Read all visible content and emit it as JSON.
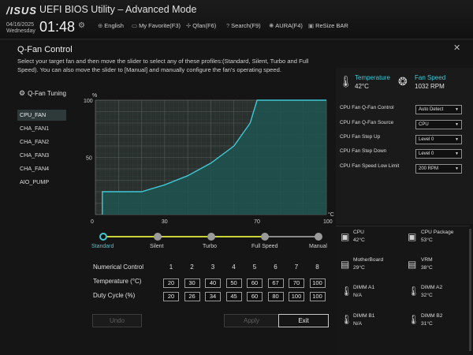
{
  "header": {
    "logo": "/ISUS",
    "title": "UEFI BIOS Utility – Advanced Mode",
    "date": "04/16/2025",
    "weekday": "Wednesday",
    "time": "01:48",
    "nav": [
      {
        "icon": "globe-icon",
        "glyph": "⊕",
        "label": "English"
      },
      {
        "icon": "favorite-icon",
        "glyph": "▭",
        "label": "My Favorite(F3)"
      },
      {
        "icon": "fan-icon",
        "glyph": "✢",
        "label": "Qfan(F6)"
      },
      {
        "icon": "search-icon",
        "glyph": "?",
        "label": "Search(F9)"
      },
      {
        "icon": "aura-icon",
        "glyph": "✺",
        "label": "AURA(F4)"
      },
      {
        "icon": "resize-bar-icon",
        "glyph": "▣",
        "label": "ReSize BAR"
      }
    ]
  },
  "dialog": {
    "title": "Q-Fan Control",
    "description": "Select your target fan and then move the slider to select any of these profiles:(Standard, Silent, Turbo and Full Speed). You can also move the slider to [Manual] and manually configure the fan's operating speed.",
    "tuning_label": "Q-Fan Tuning"
  },
  "fans": [
    "CPU_FAN",
    "CHA_FAN1",
    "CHA_FAN2",
    "CHA_FAN3",
    "CHA_FAN4",
    "AIO_PUMP"
  ],
  "chart_data": {
    "type": "line",
    "ylabel": "%",
    "xlabel": "°C",
    "xlim": [
      0,
      100
    ],
    "ylim": [
      0,
      100
    ],
    "x_ticks": [
      0,
      30,
      70,
      100
    ],
    "y_ticks": [
      50,
      100
    ],
    "series": [
      {
        "points": [
          [
            3,
            0
          ],
          [
            3,
            20
          ],
          [
            20,
            20
          ],
          [
            30,
            26
          ],
          [
            40,
            34
          ],
          [
            50,
            45
          ],
          [
            60,
            60
          ],
          [
            67,
            80
          ],
          [
            70,
            100
          ],
          [
            100,
            100
          ]
        ]
      }
    ],
    "accent": "#3fc8d6"
  },
  "profiles": {
    "items": [
      "Standard",
      "Silent",
      "Turbo",
      "Full Speed",
      "Manual"
    ],
    "active": "Standard"
  },
  "table": {
    "row_labels": [
      "Numerical Control",
      "Temperature (°C)",
      "Duty Cycle (%)"
    ],
    "numbers": [
      1,
      2,
      3,
      4,
      5,
      6,
      7,
      8
    ],
    "temperature": [
      20,
      30,
      40,
      50,
      60,
      67,
      70,
      100
    ],
    "duty": [
      20,
      26,
      34,
      45,
      60,
      80,
      100,
      100
    ]
  },
  "buttons": {
    "undo": "Undo",
    "apply": "Apply",
    "exit": "Exit"
  },
  "readout": {
    "temp_label": "Temperature",
    "temp_value": "42°C",
    "speed_label": "Fan Speed",
    "speed_value": "1032 RPM"
  },
  "settings": [
    {
      "label": "CPU Fan Q-Fan Control",
      "value": "Auto Detect"
    },
    {
      "label": "CPU Fan Q-Fan Source",
      "value": "CPU"
    },
    {
      "label": "CPU Fan Step Up",
      "value": "Level 0"
    },
    {
      "label": "CPU Fan Step Down",
      "value": "Level 0"
    },
    {
      "label": "CPU Fan Speed Low Limit",
      "value": "200 RPM"
    }
  ],
  "sensors": [
    {
      "name": "CPU",
      "value": "42°C"
    },
    {
      "name": "CPU Package",
      "value": "53°C"
    },
    {
      "name": "MotherBoard",
      "value": "29°C"
    },
    {
      "name": "VRM",
      "value": "38°C"
    },
    {
      "name": "DIMM A1",
      "value": "N/A"
    },
    {
      "name": "DIMM A2",
      "value": "32°C"
    },
    {
      "name": "DIMM B1",
      "value": "N/A"
    },
    {
      "name": "DIMM B2",
      "value": "31°C"
    }
  ]
}
